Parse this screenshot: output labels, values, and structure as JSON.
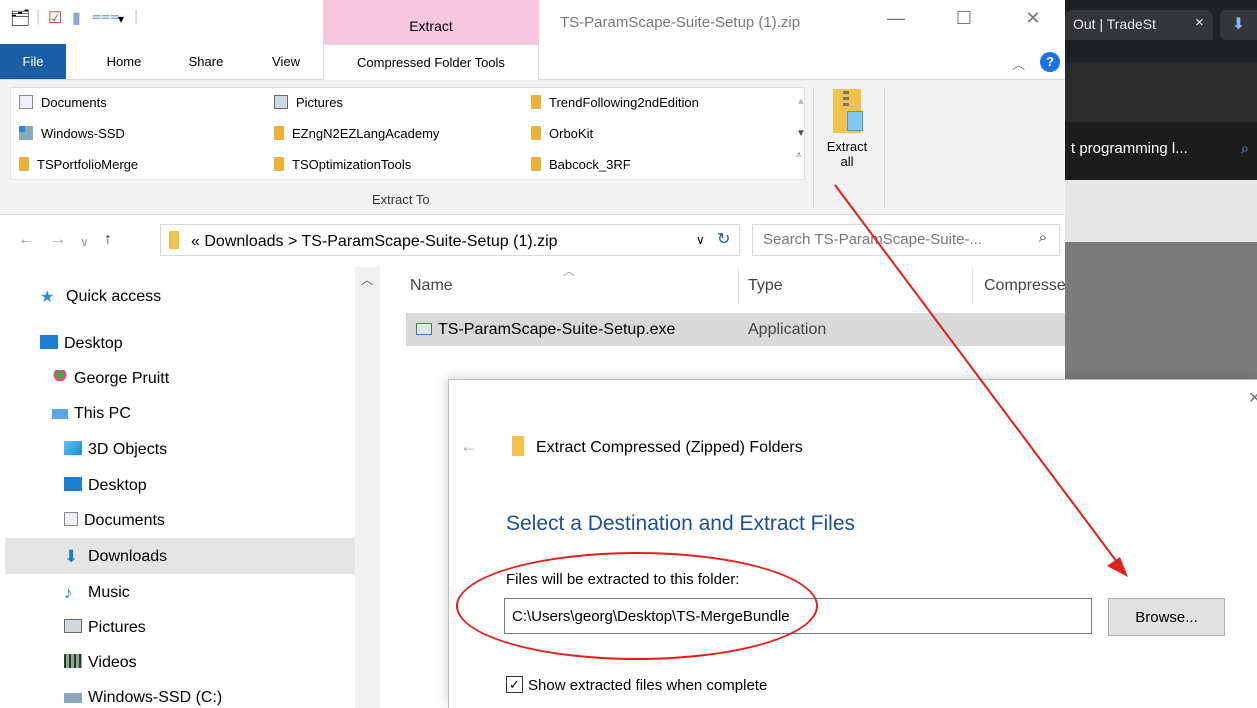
{
  "browser": {
    "tab_title": "Out | TradeSt",
    "tab_close": "×",
    "download_icon": "download-icon",
    "page_title": "t programming l...",
    "search_icon": "search-icon"
  },
  "explorer": {
    "window_title": "TS-ParamScape-Suite-Setup (1).zip",
    "context_tab": "Extract",
    "ribbon_tabs": [
      "File",
      "Home",
      "Share",
      "View",
      "Compressed Folder Tools"
    ],
    "extract_to_items": [
      [
        "Documents",
        "Pictures",
        "TrendFollowing2ndEdition"
      ],
      [
        "Windows-SSD",
        "EZngN2EZLangAcademy",
        "OrboKit"
      ],
      [
        "TSPortfolioMerge",
        "TSOptimizationTools",
        "Babcock_3RF"
      ]
    ],
    "extract_to_label": "Extract To",
    "extract_all_line1": "Extract",
    "extract_all_line2": "all",
    "address": {
      "prefix": "«",
      "seg1": "Downloads",
      "sep": ">",
      "seg2": "TS-ParamScape-Suite-Setup (1).zip"
    },
    "search_placeholder": "Search TS-ParamScape-Suite-...",
    "nav": {
      "quick_access": "Quick access",
      "desktop": "Desktop",
      "user": "George Pruitt",
      "this_pc": "This PC",
      "objects_3d": "3D Objects",
      "desktop2": "Desktop",
      "documents": "Documents",
      "downloads": "Downloads",
      "music": "Music",
      "pictures": "Pictures",
      "videos": "Videos",
      "windows_ssd": "Windows-SSD (C:)"
    },
    "columns": {
      "name": "Name",
      "type": "Type",
      "compressed": "Compresse"
    },
    "file": {
      "name": "TS-ParamScape-Suite-Setup.exe",
      "type": "Application"
    }
  },
  "dialog": {
    "title": "Extract Compressed (Zipped) Folders",
    "heading": "Select a Destination and Extract Files",
    "label": "Files will be extracted to this folder:",
    "path": "C:\\Users\\georg\\Desktop\\TS-MergeBundle",
    "browse": "Browse...",
    "checkbox_label": "Show extracted files when complete",
    "checkbox_checked": true
  },
  "colors": {
    "file_tab": "#1a5ea8",
    "context_tab": "#f7c8de",
    "annotation": "#e0201b",
    "dialog_heading": "#1f4e99"
  }
}
